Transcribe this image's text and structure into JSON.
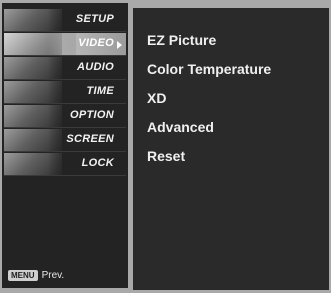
{
  "sidebar": {
    "items": [
      {
        "label": "SETUP",
        "selected": false,
        "icon": "setup-icon"
      },
      {
        "label": "VIDEO",
        "selected": true,
        "icon": "video-icon"
      },
      {
        "label": "AUDIO",
        "selected": false,
        "icon": "audio-icon"
      },
      {
        "label": "TIME",
        "selected": false,
        "icon": "time-icon"
      },
      {
        "label": "OPTION",
        "selected": false,
        "icon": "option-icon"
      },
      {
        "label": "SCREEN",
        "selected": false,
        "icon": "screen-icon"
      },
      {
        "label": "LOCK",
        "selected": false,
        "icon": "lock-icon"
      }
    ],
    "footer": {
      "key_label": "MENU",
      "prev_label": "Prev."
    }
  },
  "content": {
    "options": [
      {
        "label": "EZ Picture"
      },
      {
        "label": "Color Temperature"
      },
      {
        "label": "XD"
      },
      {
        "label": "Advanced"
      },
      {
        "label": "Reset"
      }
    ]
  },
  "colors": {
    "panel": "#2a2a2a",
    "sidebar": "#232323",
    "selected": "#b5b5b5",
    "text": "#f0f0f0"
  }
}
